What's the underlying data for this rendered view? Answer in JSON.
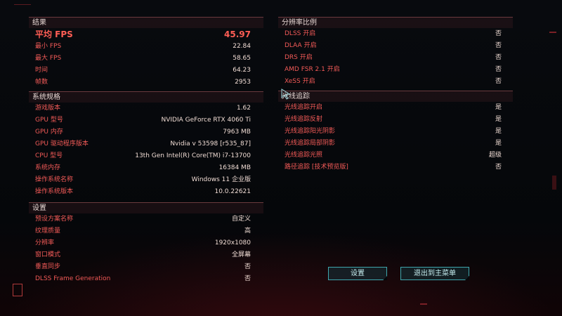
{
  "results": {
    "header": "结果",
    "avg_fps": {
      "label": "平均 FPS",
      "value": "45.97"
    },
    "rows": [
      {
        "label": "最小 FPS",
        "value": "22.84"
      },
      {
        "label": "最大 FPS",
        "value": "58.65"
      },
      {
        "label": "时间",
        "value": "64.23"
      },
      {
        "label": "帧数",
        "value": "2953"
      }
    ]
  },
  "system": {
    "header": "系统规格",
    "rows": [
      {
        "label": "游戏版本",
        "value": "1.62"
      },
      {
        "label": "GPU 型号",
        "value": "NVIDIA GeForce RTX 4060 Ti"
      },
      {
        "label": "GPU 内存",
        "value": "7963 MB"
      },
      {
        "label": "GPU 驱动程序版本",
        "value": "Nvidia v 53598 [r535_87]"
      },
      {
        "label": "CPU 型号",
        "value": "13th Gen Intel(R) Core(TM) i7-13700"
      },
      {
        "label": "系统内存",
        "value": "16384 MB"
      },
      {
        "label": "操作系统名称",
        "value": "Windows 11 企业版"
      },
      {
        "label": "操作系统版本",
        "value": "10.0.22621"
      }
    ]
  },
  "settings": {
    "header": "设置",
    "rows": [
      {
        "label": "预设方案名称",
        "value": "自定义"
      },
      {
        "label": "纹理质量",
        "value": "高"
      },
      {
        "label": "分辨率",
        "value": "1920x1080"
      },
      {
        "label": "窗口模式",
        "value": "全屏幕"
      },
      {
        "label": "垂直同步",
        "value": "否"
      },
      {
        "label": "DLSS Frame Generation",
        "value": "否"
      }
    ]
  },
  "resolution_scaling": {
    "header": "分辨率比例",
    "rows": [
      {
        "label": "DLSS 开启",
        "value": "否"
      },
      {
        "label": "DLAA 开启",
        "value": "否"
      },
      {
        "label": "DRS 开启",
        "value": "否"
      },
      {
        "label": "AMD FSR 2.1 开启",
        "value": "否"
      },
      {
        "label": "XeSS 开启",
        "value": "否"
      }
    ]
  },
  "ray_tracing": {
    "header": "光线追踪",
    "rows": [
      {
        "label": "光线追踪开启",
        "value": "是"
      },
      {
        "label": "光线追踪反射",
        "value": "是"
      },
      {
        "label": "光线追踪阳光阴影",
        "value": "是"
      },
      {
        "label": "光线追踪局部阴影",
        "value": "是"
      },
      {
        "label": "光线追踪光照",
        "value": "超级"
      },
      {
        "label": "路径追踪 [技术预览版]",
        "value": "否"
      }
    ]
  },
  "buttons": {
    "settings": "设置",
    "exit": "退出到主菜单"
  },
  "colors": {
    "label_red": "#f25a57",
    "value_light": "#f0dcd4",
    "button_cyan": "#3fa6ad"
  }
}
